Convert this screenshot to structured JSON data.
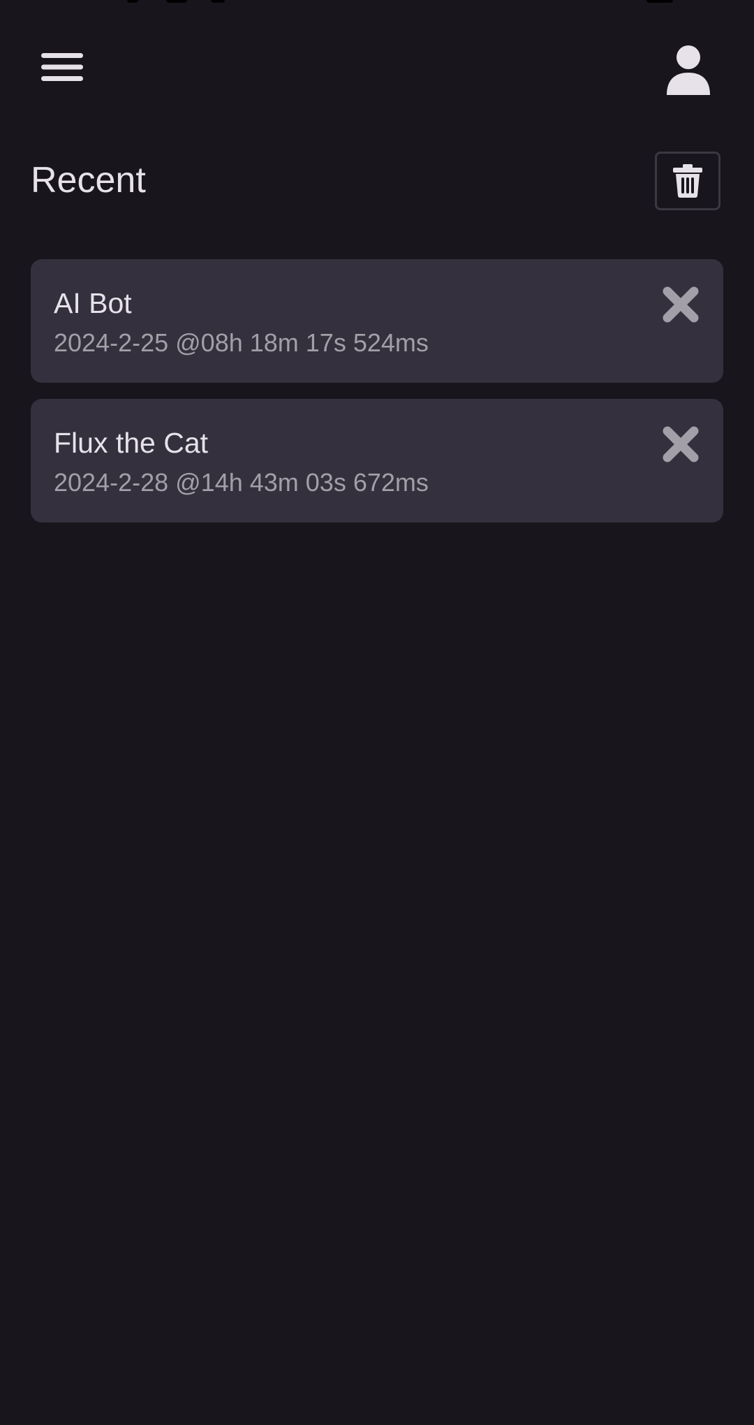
{
  "colors": {
    "background": "#18161c",
    "card": "#34303d",
    "primary_text": "#e7e2ea",
    "secondary_text": "#a29fa8",
    "icon": "#e7e2ea",
    "remove_icon": "#a29fa8"
  },
  "top_bar": {
    "menu_icon": "hamburger-menu-icon",
    "profile_icon": "person-icon"
  },
  "recent": {
    "title": "Recent",
    "clear_icon": "trash-icon",
    "items": [
      {
        "title": "AI Bot",
        "timestamp": "2024-2-25 @08h 18m 17s 524ms",
        "remove_icon": "close-icon"
      },
      {
        "title": "Flux the Cat",
        "timestamp": "2024-2-28 @14h 43m 03s 672ms",
        "remove_icon": "close-icon"
      }
    ]
  }
}
